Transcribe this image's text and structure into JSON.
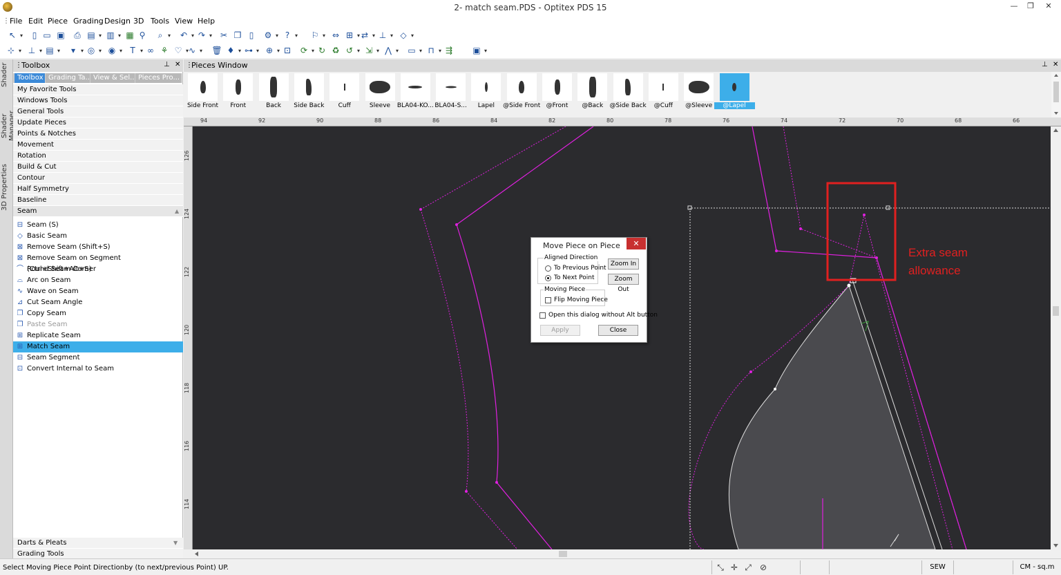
{
  "window": {
    "title": "2- match seam.PDS - Optitex PDS 15",
    "minimize": "—",
    "restore": "❐",
    "close": "✕"
  },
  "menu": [
    "File",
    "Edit",
    "Piece",
    "Grading",
    "Design",
    "3D",
    "Tools",
    "View",
    "Help"
  ],
  "side_tabs": [
    "Shader",
    "Shader Manager",
    "3D Properties"
  ],
  "toolbox": {
    "title": "Toolbox",
    "tabs": [
      "Toolbox",
      "Grading Ta...",
      "View & Sel...",
      "Pieces Pro..."
    ],
    "categories": [
      "My Favorite Tools",
      "Windows Tools",
      "General Tools",
      "Update Pieces",
      "Points & Notches",
      "Movement",
      "Rotation",
      "Build & Cut",
      "Contour",
      "Half Symmetry",
      "Baseline",
      "Seam"
    ],
    "tools": [
      {
        "label": "Seam (S)",
        "icon": "seam-icon",
        "state": "normal"
      },
      {
        "label": "Basic Seam",
        "icon": "basic-seam-icon",
        "state": "normal"
      },
      {
        "label": "Remove Seam (Shift+S)",
        "icon": "remove-seam-icon",
        "state": "normal"
      },
      {
        "label": "Remove Seam on Segment (Ctrl+Shift+Alt+S)",
        "icon": "remove-seam-segment-icon",
        "state": "normal"
      },
      {
        "label": "Round Seam Corner",
        "icon": "round-corner-icon",
        "state": "normal"
      },
      {
        "label": "Arc on Seam",
        "icon": "arc-icon",
        "state": "normal"
      },
      {
        "label": "Wave on Seam",
        "icon": "wave-icon",
        "state": "normal"
      },
      {
        "label": "Cut Seam Angle",
        "icon": "cut-angle-icon",
        "state": "normal"
      },
      {
        "label": "Copy Seam",
        "icon": "copy-seam-icon",
        "state": "normal"
      },
      {
        "label": "Paste Seam",
        "icon": "paste-seam-icon",
        "state": "disabled"
      },
      {
        "label": "Replicate Seam",
        "icon": "replicate-icon",
        "state": "normal"
      },
      {
        "label": "Match Seam",
        "icon": "match-seam-icon",
        "state": "selected"
      },
      {
        "label": "Seam Segment",
        "icon": "seam-segment-icon",
        "state": "normal"
      },
      {
        "label": "Convert Internal to Seam",
        "icon": "convert-icon",
        "state": "normal"
      }
    ],
    "bottom_categories": [
      "Darts & Pleats",
      "Grading Tools"
    ]
  },
  "pieces_window": {
    "title": "Pieces Window",
    "pieces": [
      {
        "label": "Side Front",
        "selected": false
      },
      {
        "label": "Front",
        "selected": false
      },
      {
        "label": "Back",
        "selected": false
      },
      {
        "label": "Side Back",
        "selected": false
      },
      {
        "label": "Cuff",
        "selected": false
      },
      {
        "label": "Sleeve",
        "selected": false
      },
      {
        "label": "BLA04-KO...",
        "selected": false
      },
      {
        "label": "BLA04-S...",
        "selected": false
      },
      {
        "label": "Lapel",
        "selected": false
      },
      {
        "label": "@Side Front",
        "selected": false
      },
      {
        "label": "@Front",
        "selected": false
      },
      {
        "label": "@Back",
        "selected": false
      },
      {
        "label": "@Side Back",
        "selected": false
      },
      {
        "label": "@Cuff",
        "selected": false
      },
      {
        "label": "@Sleeve",
        "selected": false
      },
      {
        "label": "@Lapel",
        "selected": true
      }
    ]
  },
  "ruler": {
    "top": [
      "94",
      "92",
      "90",
      "88",
      "86",
      "84",
      "82",
      "80",
      "78",
      "76",
      "74",
      "72",
      "70",
      "68",
      "66"
    ],
    "left": [
      "126",
      "124",
      "122",
      "120",
      "118",
      "116",
      "114"
    ]
  },
  "canvas": {
    "annotation_line1": "Extra seam",
    "annotation_line2": "allowance",
    "colors": {
      "background": "#2b2b2e",
      "seam": "#e020e0",
      "highlight_box": "#e02020",
      "piece_fill": "#4a4a4e"
    }
  },
  "dialog": {
    "title": "Move Piece on Piece",
    "close_label": "✕",
    "aligned_direction_label": "Aligned Direction",
    "to_previous": "To Previous Point",
    "to_next": "To Next Point",
    "selected_direction": "next",
    "zoom_in": "Zoom In",
    "zoom_out": "Zoom Out",
    "moving_piece_label": "Moving Piece",
    "flip_moving_piece": "Flip Moving Piece",
    "flip_checked": false,
    "open_without_alt": "Open this dialog without Alt button",
    "open_without_alt_checked": false,
    "apply": "Apply",
    "close": "Close"
  },
  "status": {
    "message": "Select Moving Piece Point Directionby (to next/previous Point) UP.",
    "mode": "SEW",
    "units": "CM - sq.m"
  }
}
